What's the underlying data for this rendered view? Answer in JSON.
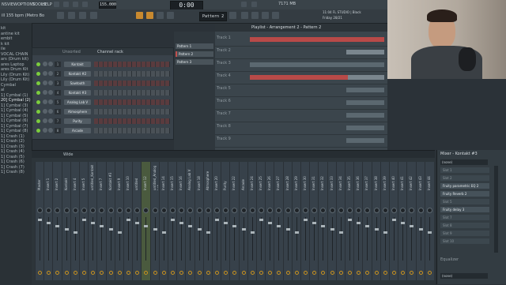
{
  "menu": {
    "items": [
      "NS",
      "VIEW",
      "OPTIONS",
      "TOOLS",
      "HELP"
    ],
    "song_info": "ill 155 bpm (Metro Bo"
  },
  "toolbar": {
    "tempo": "155.000",
    "time": "0:00",
    "time_sub": "00",
    "pattern": "Pattern 2",
    "cpu": "7171 MB",
    "version_line1": "11:04 FL STUDIO | Black",
    "version_line2": "Friday 28/21"
  },
  "browser": {
    "items": [
      "kit",
      "antine kit",
      "embit",
      "k kit",
      "ile",
      "VOCAL CHAIN",
      "ars (Drum kit)",
      "ares Laptop",
      "ares Drum Kit",
      "Lily (Drum Kit)",
      "Lily (Drum Kit)",
      "Cymbal",
      "al",
      "1] Cymbal (1)",
      "20] Cymbal (2)",
      "1] Cymbal (3)",
      "1] Cymbal (4)",
      "1] Cymbal (5)",
      "1] Cymbal (6)",
      "1] Cymbal (7)",
      "1] Cymbal (8)",
      "1] Crash (1)",
      "1] Crash (2)",
      "1] Crash (3)",
      "1] Crash (4)",
      "1] Crash (5)",
      "1] Crash (6)",
      "1] Crash (7)",
      "1] Crash (8)"
    ]
  },
  "channel_rack": {
    "title": "Channel rack",
    "filter": "Unsorted",
    "channels": [
      {
        "num": "1",
        "name": "Kontakt"
      },
      {
        "num": "2",
        "name": "Kontakt #2"
      },
      {
        "num": "3",
        "name": "Sawtooth"
      },
      {
        "num": "4",
        "name": "Kontakt #3"
      },
      {
        "num": "5",
        "name": "Analog Lab V"
      },
      {
        "num": "6",
        "name": "Atmosphere"
      },
      {
        "num": "7",
        "name": "Purity"
      },
      {
        "num": "8",
        "name": "Arcade"
      }
    ]
  },
  "patterns": [
    "Pattern 1",
    "Pattern 2",
    "Pattern 3"
  ],
  "playlist": {
    "title": "Playlist - Arrangement 2 - Pattern 2",
    "tracks": [
      "Track 1",
      "Track 2",
      "Track 3",
      "Track 4",
      "Track 5",
      "Track 6",
      "Track 7",
      "Track 8",
      "Track 9"
    ]
  },
  "mixer": {
    "title": "Wide",
    "strips": [
      "Master",
      "Insert 1",
      "Insert 2",
      "Kontakt",
      "Insert 4",
      "Insert 5",
      "untitled_Kontakt",
      "Insert 7",
      "Kontakt #3",
      "Insert 9",
      "Insert 10",
      "untitled",
      "Insert 12",
      "untitled_Analog Lab",
      "Insert 14",
      "Insert 15",
      "Insert 16",
      "Analog Lab V",
      "Insert 18",
      "Atmosphere",
      "Insert 20",
      "Purity",
      "Insert 22",
      "Arcade",
      "Insert 24",
      "Insert 25",
      "Insert 26",
      "Insert 27",
      "Insert 28",
      "Insert 29",
      "Insert 30",
      "Insert 31",
      "Insert 32",
      "Insert 33",
      "Insert 34",
      "Insert 35",
      "Insert 36",
      "Insert 37",
      "Insert 38",
      "Insert 39",
      "Insert 40",
      "Insert 41",
      "Insert 42",
      "Insert 43",
      "Insert 44"
    ]
  },
  "insert_panel": {
    "title": "Mixer - Kontakt #3",
    "input": "(none)",
    "slots": [
      "Slot 1",
      "Slot 2",
      "Fruity parametric EQ 2",
      "Fruity Reverb 2",
      "Slot 5",
      "Fruity delay 3",
      "Slot 7",
      "Slot 8",
      "Slot 9",
      "Slot 10"
    ],
    "equalizer": "Equalizer",
    "output": "(none)"
  },
  "colors": {
    "accent": "#c8892f",
    "clip_red": "#c0504d",
    "led_green": "#7ccd3d"
  }
}
